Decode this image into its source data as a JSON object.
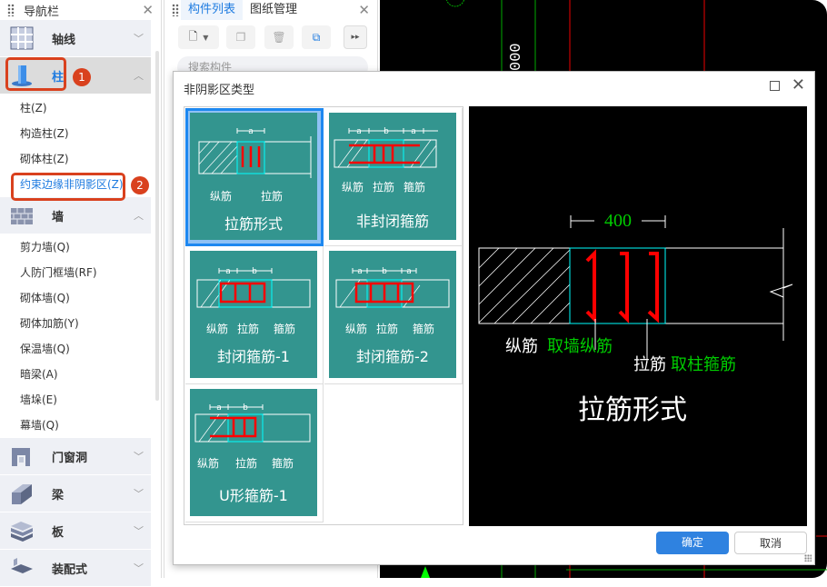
{
  "nav": {
    "title": "导航栏",
    "groups": [
      {
        "label": "轴线"
      },
      {
        "label": "柱",
        "items": [
          "柱(Z)",
          "构造柱(Z)",
          "砌体柱(Z)",
          "约束边缘非阴影区(Z)"
        ]
      },
      {
        "label": "墙",
        "items": [
          "剪力墙(Q)",
          "人防门框墙(RF)",
          "砌体墙(Q)",
          "砌体加筋(Y)",
          "保温墙(Q)",
          "暗梁(A)",
          "墙垛(E)",
          "幕墙(Q)"
        ]
      },
      {
        "label": "门窗洞"
      },
      {
        "label": "梁"
      },
      {
        "label": "板"
      },
      {
        "label": "装配式"
      }
    ],
    "badges": [
      "1",
      "2"
    ]
  },
  "panel": {
    "tabs": [
      "构件列表",
      "图纸管理"
    ],
    "search_placeholder": "搜索构件"
  },
  "cad": {
    "dim_text": "000"
  },
  "dialog": {
    "title": "非阴影区类型",
    "options": [
      {
        "label": "拉筋形式",
        "parts": [
          "纵筋",
          "拉筋"
        ],
        "dims": [
          "a"
        ]
      },
      {
        "label": "非封闭箍筋",
        "parts": [
          "纵筋",
          "拉筋",
          "箍筋"
        ],
        "dims": [
          "a",
          "b",
          "a"
        ]
      },
      {
        "label": "封闭箍筋-1",
        "parts": [
          "纵筋",
          "拉筋",
          "箍筋"
        ],
        "dims": [
          "a",
          "b"
        ]
      },
      {
        "label": "封闭箍筋-2",
        "parts": [
          "纵筋",
          "拉筋",
          "箍筋"
        ],
        "dims": [
          "a",
          "b",
          "a"
        ]
      },
      {
        "label": "U形箍筋-1",
        "parts": [
          "纵筋",
          "拉筋",
          "箍筋"
        ],
        "dims": [
          "a",
          "b"
        ]
      }
    ],
    "selected": "拉筋形式",
    "preview": {
      "dimension": "400",
      "note1_white": "纵筋",
      "note1_green": "取墙纵筋",
      "note2_white": "拉筋",
      "note2_green": "取柱箍筋",
      "title": "拉筋形式"
    },
    "ok": "确定",
    "cancel": "取消"
  },
  "colors": {
    "accent": "#1e7be0",
    "teal": "#33958f",
    "annotation": "#d9411e"
  }
}
